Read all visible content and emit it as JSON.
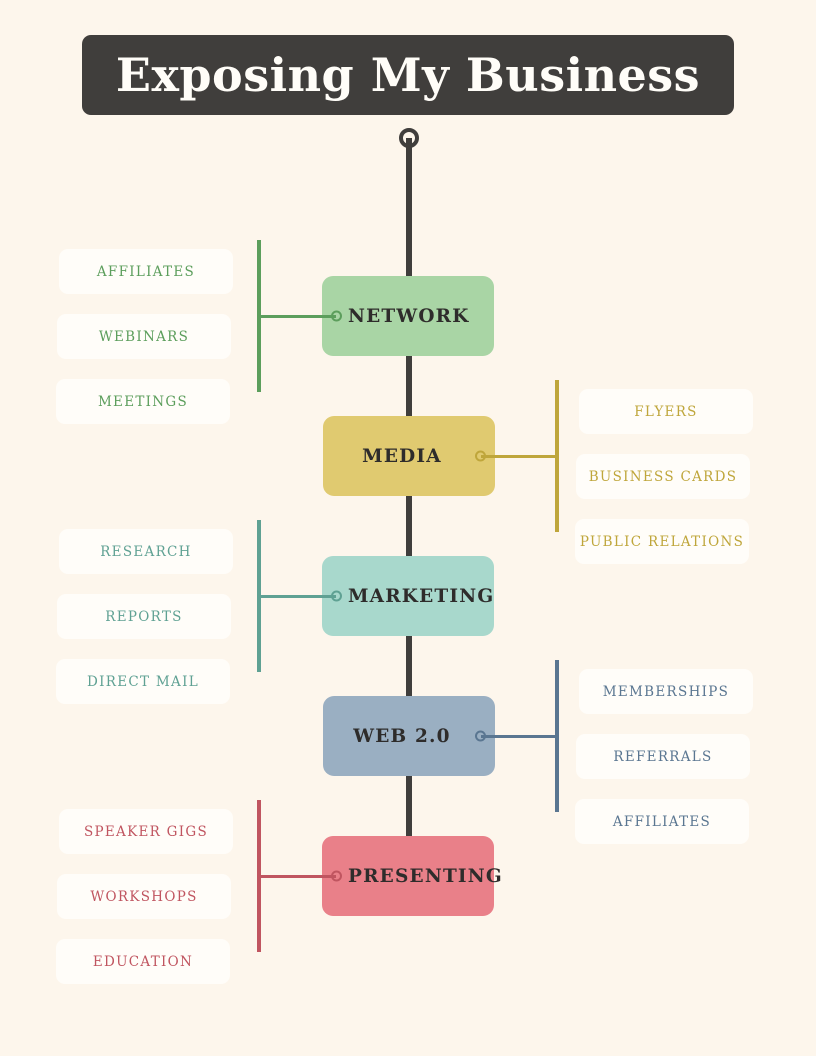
{
  "header": {
    "title": "Exposing My Business"
  },
  "theme": {
    "background": "#FDF6EC",
    "title_bar": "#403E3C",
    "title_text": "#FFFDF8",
    "spine": "#403E3C",
    "chip_background": "#FFFDF9"
  },
  "diagram": {
    "type": "vertical-spine-mindmap",
    "top_connector_icon": "ring-node-icon",
    "branches": [
      {
        "id": "network",
        "label": "NETWORK",
        "color": "#A9D5A5",
        "line_color": "#5C9E5C",
        "side": "left",
        "leaves": [
          "AFFILIATES",
          "WEBINARS",
          "MEETINGS"
        ]
      },
      {
        "id": "media",
        "label": "MEDIA",
        "color": "#E0CA70",
        "line_color": "#BFA63B",
        "side": "right",
        "leaves": [
          "FLYERS",
          "BUSINESS CARDS",
          "PUBLIC RELATIONS"
        ]
      },
      {
        "id": "marketing",
        "label": "MARKETING",
        "color": "#A8D8CC",
        "line_color": "#5FA193",
        "side": "left",
        "leaves": [
          "RESEARCH",
          "REPORTS",
          "DIRECT MAIL"
        ]
      },
      {
        "id": "web20",
        "label": "WEB 2.0",
        "color": "#9AAFC2",
        "line_color": "#5A7691",
        "side": "right",
        "leaves": [
          "MEMBERSHIPS",
          "REFERRALS",
          "AFFILIATES"
        ]
      },
      {
        "id": "presenting",
        "label": "PRESENTING",
        "color": "#E98089",
        "line_color": "#C05560",
        "side": "left",
        "leaves": [
          "SPEAKER GIGS",
          "WORKSHOPS",
          "EDUCATION"
        ]
      }
    ]
  }
}
